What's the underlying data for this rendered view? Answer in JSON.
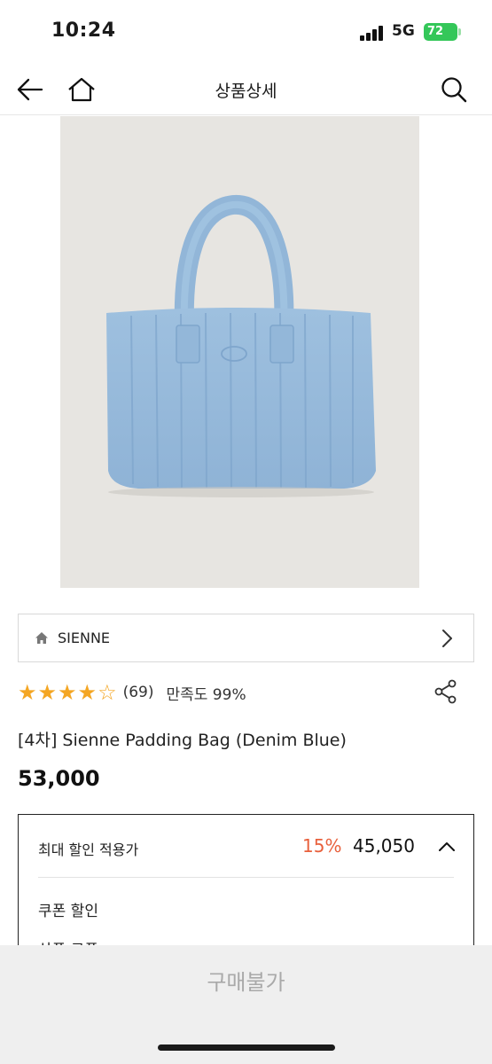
{
  "status_bar": {
    "time": "10:24",
    "network": "5G",
    "battery": "72"
  },
  "header": {
    "title": "상품상세",
    "back_icon": "back-arrow-icon",
    "home_icon": "home-icon",
    "search_icon": "search-icon"
  },
  "brand": {
    "name": "SIENNE",
    "icon": "home-icon"
  },
  "rating": {
    "stars_filled": 4.5,
    "stars_max": 5,
    "review_count": "(69)",
    "satisfaction": "만족도 99%"
  },
  "product": {
    "title": "[4차] Sienne Padding Bag (Denim Blue)",
    "price": "53,000"
  },
  "discount": {
    "label": "최대 할인 적용가",
    "rate": "15%",
    "price": "45,050",
    "coupon_label": "쿠폰 할인",
    "next_label": "상품 쿠폰"
  },
  "buy_button": {
    "label": "구매불가"
  },
  "colors": {
    "accent": "#e8603c",
    "star": "#f4a623",
    "battery": "#34c759"
  }
}
